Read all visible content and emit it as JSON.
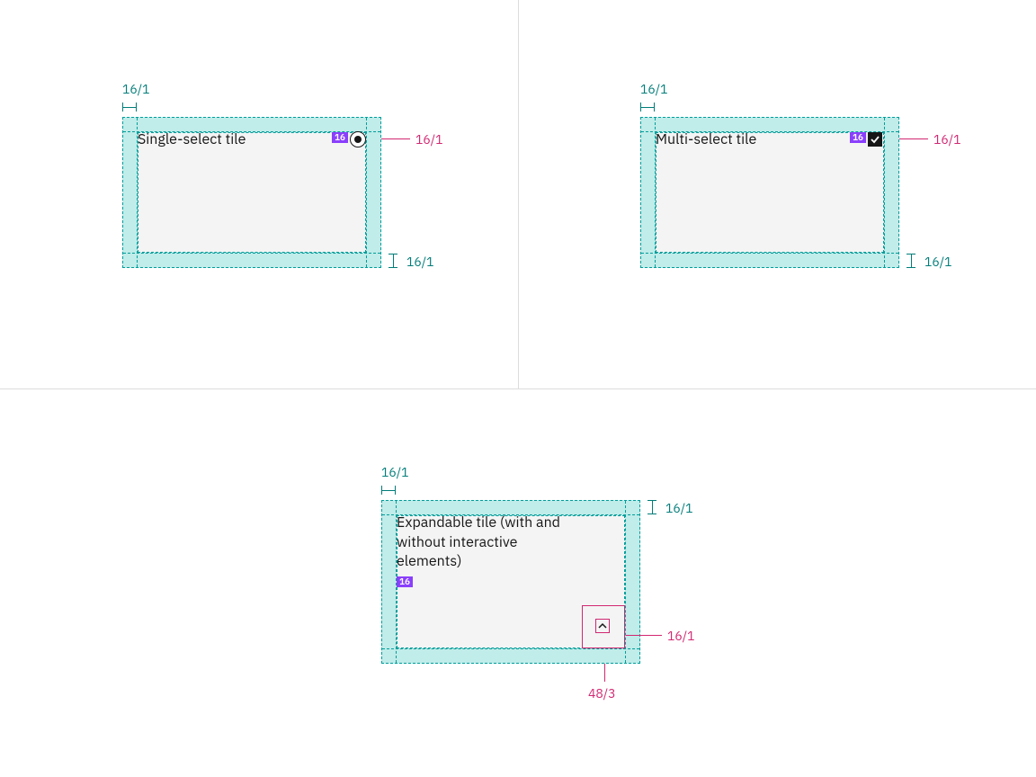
{
  "dims": {
    "pad": "16/1",
    "icon": "16/1",
    "expand_tap": "48/3"
  },
  "badges": {
    "sixteen": "16"
  },
  "tiles": {
    "single": {
      "title": "Single-select tile"
    },
    "multi": {
      "title": "Multi-select tile"
    },
    "expand": {
      "title": "Expandable tile (with and without interactive elements)"
    }
  }
}
